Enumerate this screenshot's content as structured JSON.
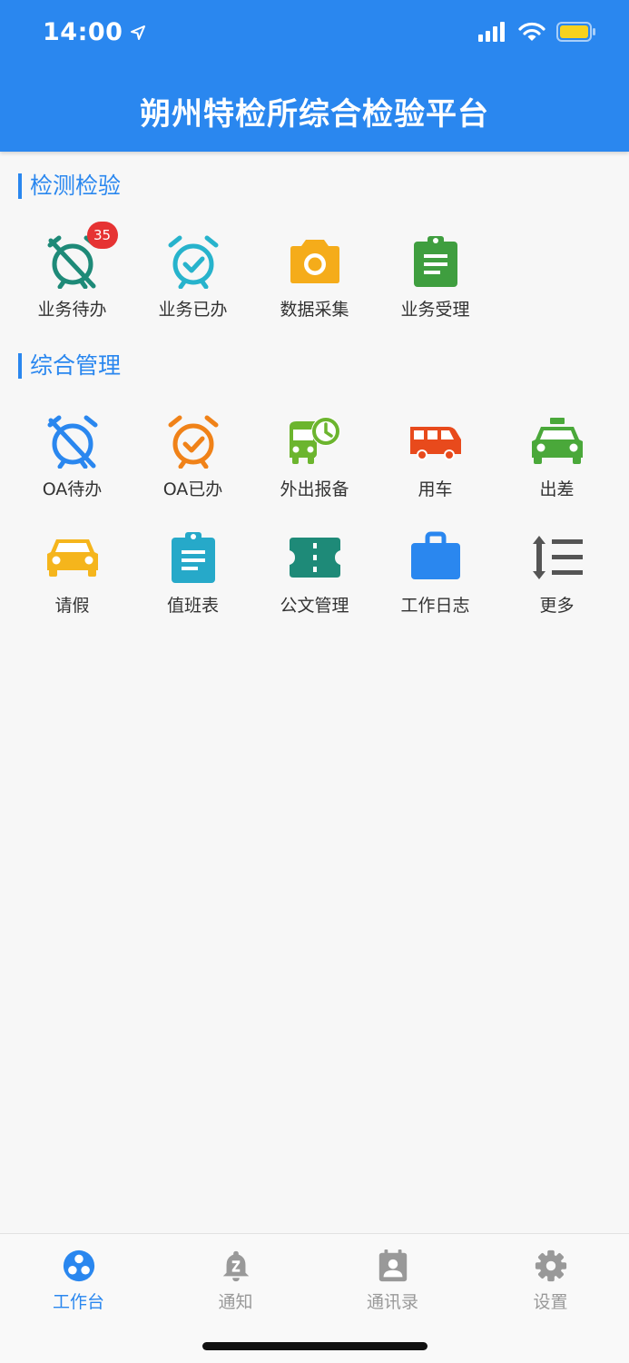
{
  "status_bar": {
    "time": "14:00"
  },
  "header": {
    "title": "朔州特检所综合检验平台"
  },
  "sections": {
    "inspection": {
      "title": "检测检验",
      "items": [
        {
          "label": "业务待办",
          "icon": "alarm-off-icon",
          "color": "#1e8a78",
          "badge": "35"
        },
        {
          "label": "业务已办",
          "icon": "alarm-check-icon",
          "color": "#27b3cc"
        },
        {
          "label": "数据采集",
          "icon": "camera-icon",
          "color": "#f5ac1a"
        },
        {
          "label": "业务受理",
          "icon": "clipboard-text-icon",
          "color": "#3f9e3f"
        }
      ]
    },
    "management": {
      "title": "综合管理",
      "items": [
        {
          "label": "OA待办",
          "icon": "alarm-off-icon",
          "color": "#2a87ef"
        },
        {
          "label": "OA已办",
          "icon": "alarm-check-icon",
          "color": "#f08218"
        },
        {
          "label": "外出报备",
          "icon": "bus-clock-icon",
          "color": "#6cb52e"
        },
        {
          "label": "用车",
          "icon": "van-icon",
          "color": "#e84a1c"
        },
        {
          "label": "出差",
          "icon": "taxi-icon",
          "color": "#4aa83a"
        },
        {
          "label": "请假",
          "icon": "car-icon",
          "color": "#f5b51c"
        },
        {
          "label": "值班表",
          "icon": "clipboard-text-icon",
          "color": "#26a9c9"
        },
        {
          "label": "公文管理",
          "icon": "ticket-icon",
          "color": "#1e8a78"
        },
        {
          "label": "工作日志",
          "icon": "briefcase-icon",
          "color": "#2a87ef"
        },
        {
          "label": "更多",
          "icon": "sort-lines-icon",
          "color": "#555555"
        }
      ]
    }
  },
  "tabbar": {
    "active_color": "#2a87ef",
    "inactive_color": "#999999",
    "tabs": [
      {
        "label": "工作台",
        "icon": "workbench-icon",
        "active": true
      },
      {
        "label": "通知",
        "icon": "bell-icon",
        "active": false
      },
      {
        "label": "通讯录",
        "icon": "contacts-icon",
        "active": false
      },
      {
        "label": "设置",
        "icon": "gear-icon",
        "active": false
      }
    ]
  }
}
